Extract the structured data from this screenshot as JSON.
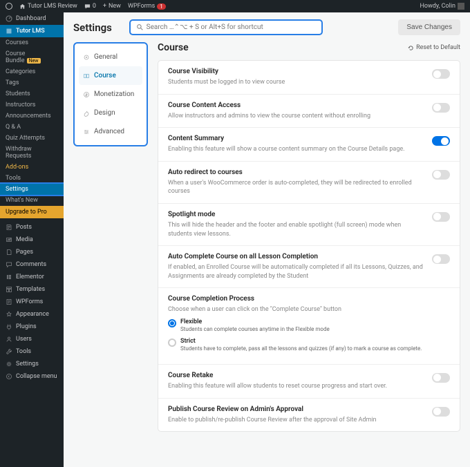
{
  "adminbar": {
    "site": "Tutor LMS Review",
    "comments": "0",
    "new": "New",
    "wpforms": "WPForms",
    "wpforms_count": "1",
    "greeting": "Howdy, Colin"
  },
  "sidebar": {
    "dashboard": "Dashboard",
    "tutor": "Tutor LMS",
    "sub": [
      {
        "label": "Courses"
      },
      {
        "label": "Course Bundle",
        "badge": "New"
      },
      {
        "label": "Categories"
      },
      {
        "label": "Tags"
      },
      {
        "label": "Students"
      },
      {
        "label": "Instructors"
      },
      {
        "label": "Announcements"
      },
      {
        "label": "Q & A"
      },
      {
        "label": "Quiz Attempts"
      },
      {
        "label": "Withdraw Requests"
      },
      {
        "label": "Add-ons",
        "orange": true
      },
      {
        "label": "Tools"
      },
      {
        "label": "Settings",
        "hl": true
      },
      {
        "label": "What's New"
      }
    ],
    "upgrade": "Upgrade to Pro",
    "wp": [
      "Posts",
      "Media",
      "Pages",
      "Comments",
      "Elementor",
      "Templates",
      "WPForms",
      "Appearance",
      "Plugins",
      "Users",
      "Tools",
      "Settings"
    ],
    "collapse": "Collapse menu"
  },
  "header": {
    "title": "Settings",
    "search_placeholder": "Search …⌃⌥ + S or Alt+S for shortcut",
    "save": "Save Changes"
  },
  "tabs": [
    {
      "id": "general",
      "label": "General"
    },
    {
      "id": "course",
      "label": "Course",
      "active": true
    },
    {
      "id": "monetization",
      "label": "Monetization"
    },
    {
      "id": "design",
      "label": "Design"
    },
    {
      "id": "advanced",
      "label": "Advanced"
    }
  ],
  "panel": {
    "title": "Course",
    "reset": "Reset to Default",
    "settings": [
      {
        "title": "Course Visibility",
        "desc": "Students must be logged in to view course",
        "type": "toggle",
        "on": false
      },
      {
        "title": "Course Content Access",
        "desc": "Allow instructors and admins to view the course content without enrolling",
        "type": "toggle",
        "on": false
      },
      {
        "title": "Content Summary",
        "desc": "Enabling this feature will show a course content summary on the Course Details page.",
        "type": "toggle",
        "on": true
      },
      {
        "title": "Auto redirect to courses",
        "desc": "When a user's WooCommerce order is auto-completed, they will be redirected to enrolled courses",
        "type": "toggle",
        "on": false
      },
      {
        "title": "Spotlight mode",
        "desc": "This will hide the header and the footer and enable spotlight (full screen) mode when students view lessons.",
        "type": "toggle",
        "on": false
      },
      {
        "title": "Auto Complete Course on all Lesson Completion",
        "desc": "If enabled, an Enrolled Course will be automatically completed if all its Lessons, Quizzes, and Assignments are already completed by the Student",
        "type": "toggle",
        "on": false
      },
      {
        "title": "Course Completion Process",
        "desc": "Choose when a user can click on the \"Complete Course\" button",
        "type": "radio",
        "options": [
          {
            "label": "Flexible",
            "desc": "Students can complete courses anytime in the Flexible mode",
            "sel": true
          },
          {
            "label": "Strict",
            "desc": "Students have to complete, pass all the lessons and quizzes (if any) to mark a course as complete.",
            "sel": false
          }
        ]
      },
      {
        "title": "Course Retake",
        "desc": "Enabling this feature will allow students to reset course progress and start over.",
        "type": "toggle",
        "on": false
      },
      {
        "title": "Publish Course Review on Admin's Approval",
        "desc": "Enable to publish/re-publish Course Review after the approval of Site Admin",
        "type": "toggle",
        "on": false
      }
    ]
  }
}
